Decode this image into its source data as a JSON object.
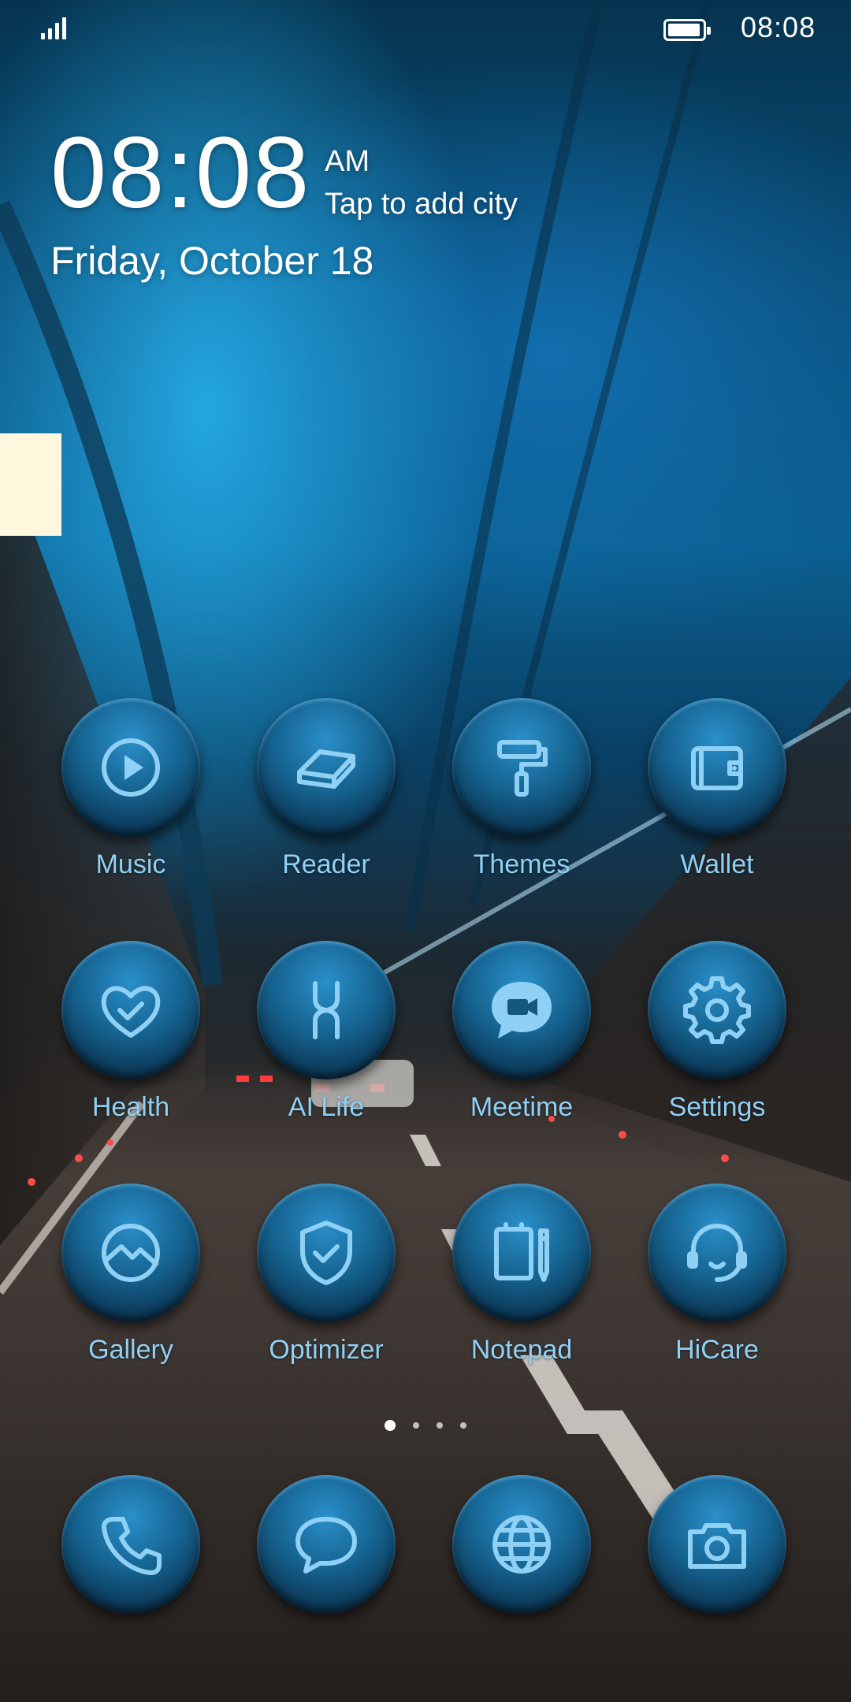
{
  "status_bar": {
    "time": "08:08",
    "signal_bars": 4,
    "battery_level": 0.95
  },
  "clock_widget": {
    "time": "08:08",
    "ampm": "AM",
    "city_prompt": "Tap to add city",
    "date": "Friday, October 18"
  },
  "apps": [
    {
      "label": "Music",
      "icon": "play-circle-icon"
    },
    {
      "label": "Reader",
      "icon": "book-icon"
    },
    {
      "label": "Themes",
      "icon": "paint-roller-icon"
    },
    {
      "label": "Wallet",
      "icon": "wallet-icon"
    },
    {
      "label": "Health",
      "icon": "heart-check-icon"
    },
    {
      "label": "AI Life",
      "icon": "ai-life-icon"
    },
    {
      "label": "Meetime",
      "icon": "video-chat-icon"
    },
    {
      "label": "Settings",
      "icon": "gear-icon"
    },
    {
      "label": "Gallery",
      "icon": "gallery-icon"
    },
    {
      "label": "Optimizer",
      "icon": "shield-check-icon"
    },
    {
      "label": "Notepad",
      "icon": "notepad-icon"
    },
    {
      "label": "HiCare",
      "icon": "headset-icon"
    }
  ],
  "page_indicator": {
    "pages": 4,
    "current": 1
  },
  "dock": [
    {
      "icon": "phone-icon"
    },
    {
      "icon": "message-icon"
    },
    {
      "icon": "browser-globe-icon"
    },
    {
      "icon": "camera-icon"
    }
  ],
  "colors": {
    "icon_tint": "#8fd0f5",
    "icon_bg": "#15628f",
    "label": "#8fd0f5"
  }
}
